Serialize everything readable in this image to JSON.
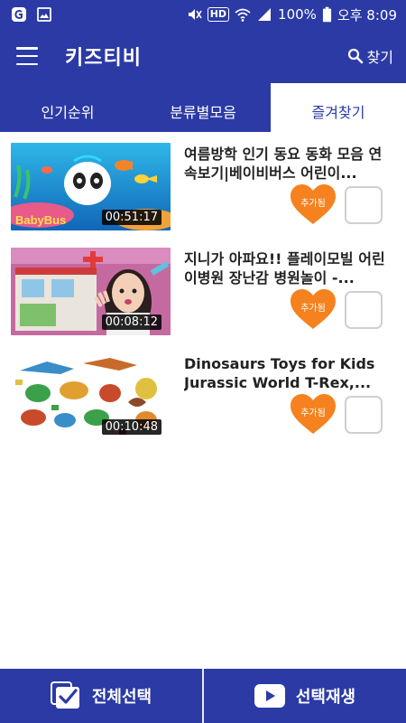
{
  "status_bar": {
    "hd_label": "HD",
    "battery": "100%",
    "time": "오후 8:09"
  },
  "app_bar": {
    "title": "키즈티비",
    "search_label": "찾기"
  },
  "tabs": [
    {
      "label": "인기순위",
      "active": false
    },
    {
      "label": "분류별모음",
      "active": false
    },
    {
      "label": "즐겨찾기",
      "active": true
    }
  ],
  "videos": [
    {
      "title": "여름방학 인기 동요 동화 모음 연속보기|베이비버스 어린이...",
      "duration": "00:51:17",
      "favorite_label": "추가됨"
    },
    {
      "title": "지니가 아파요!! 플레이모빌 어린이병원 장난감 병원놀이 -...",
      "duration": "00:08:12",
      "favorite_label": "추가됨"
    },
    {
      "title": "Dinosaurs Toys for Kids Jurassic World T-Rex,...",
      "duration": "00:10:48",
      "favorite_label": "추가됨"
    }
  ],
  "thumbnail_text": {
    "babybus_logo": "BabyBus"
  },
  "bottom_bar": {
    "select_all_label": "전체선택",
    "play_selected_label": "선택재생"
  },
  "colors": {
    "primary": "#2b3aa5",
    "heart": "#f5821f",
    "checkbox_border": "#cfcfcf"
  },
  "icons": {
    "menu": "hamburger-icon",
    "search": "search-icon",
    "favorite": "heart-icon",
    "select_all": "checkbox-checked-icon",
    "play": "play-icon"
  }
}
